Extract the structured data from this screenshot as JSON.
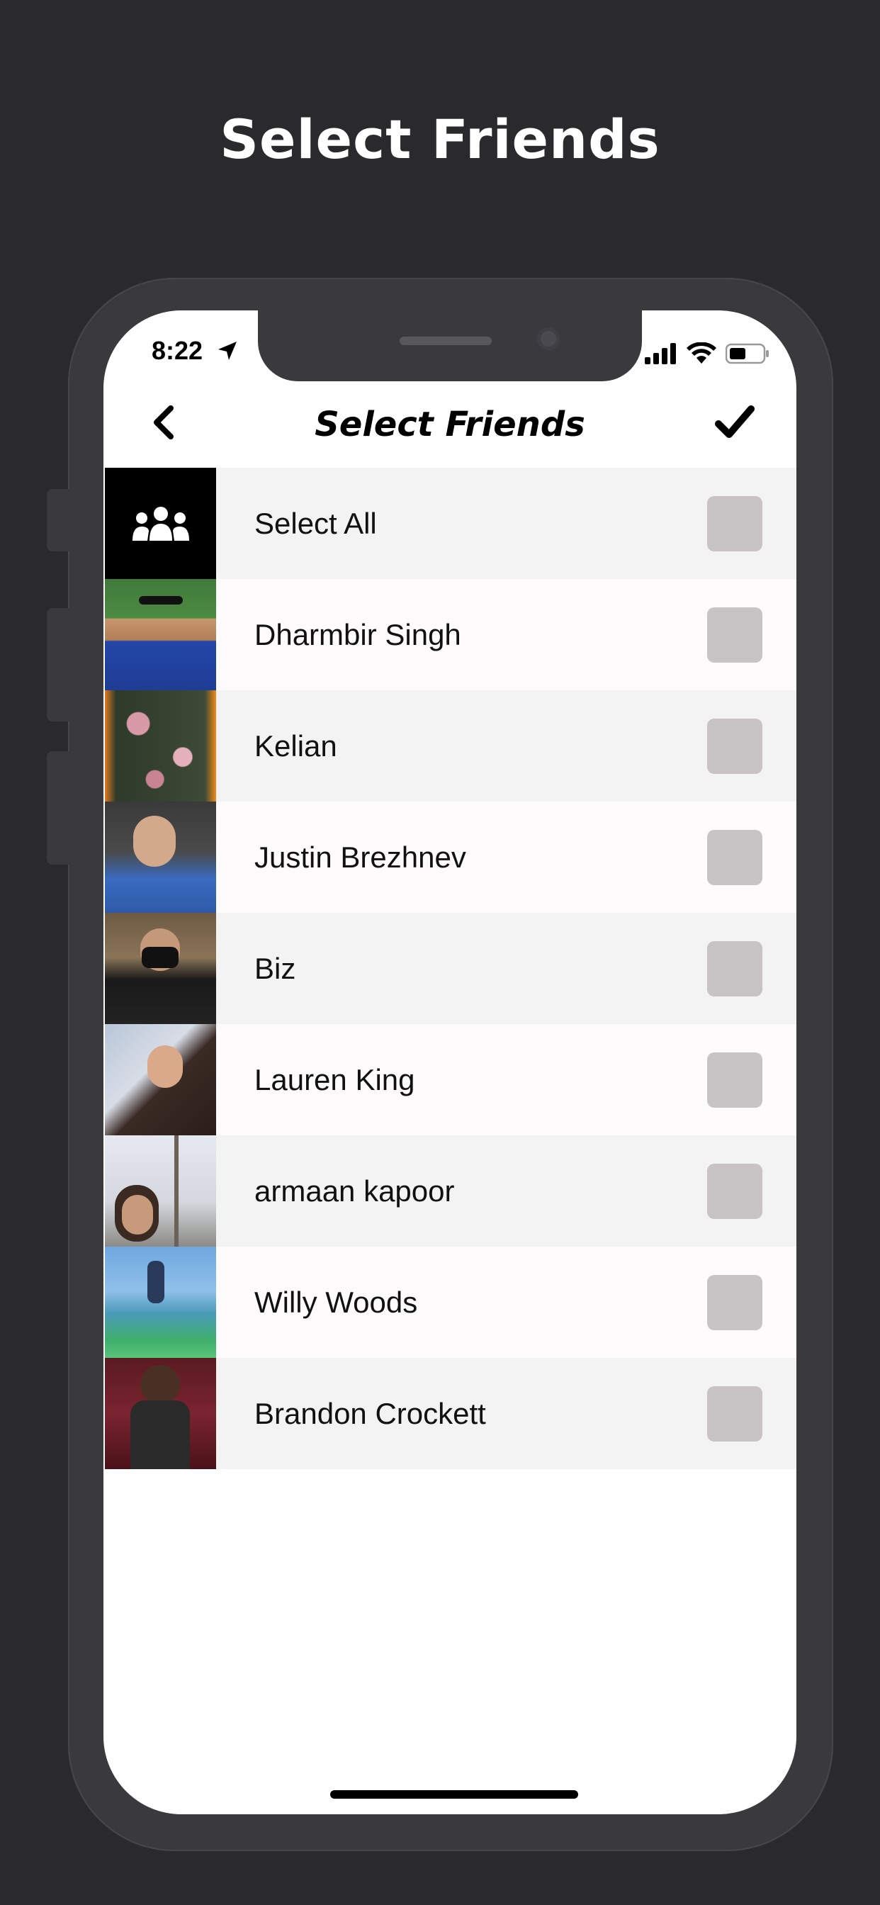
{
  "promo": {
    "title": "Select Friends"
  },
  "status_bar": {
    "time": "8:22"
  },
  "nav": {
    "title": "Select Friends",
    "back_icon": "chevron-left-icon",
    "done_icon": "checkmark-icon"
  },
  "list": {
    "select_all": {
      "label": "Select All",
      "icon": "group-icon"
    },
    "friends": [
      {
        "name": "Dharmbir Singh"
      },
      {
        "name": "Kelian"
      },
      {
        "name": "Justin Brezhnev"
      },
      {
        "name": "Biz"
      },
      {
        "name": "Lauren King"
      },
      {
        "name": "armaan kapoor"
      },
      {
        "name": "Willy Woods"
      },
      {
        "name": "Brandon Crockett"
      }
    ]
  },
  "colors": {
    "background": "#2a2a2c",
    "row_light": "#f4f3f4",
    "row_lighter": "#fdfbfc",
    "checkbox": "#c8c4c5"
  }
}
